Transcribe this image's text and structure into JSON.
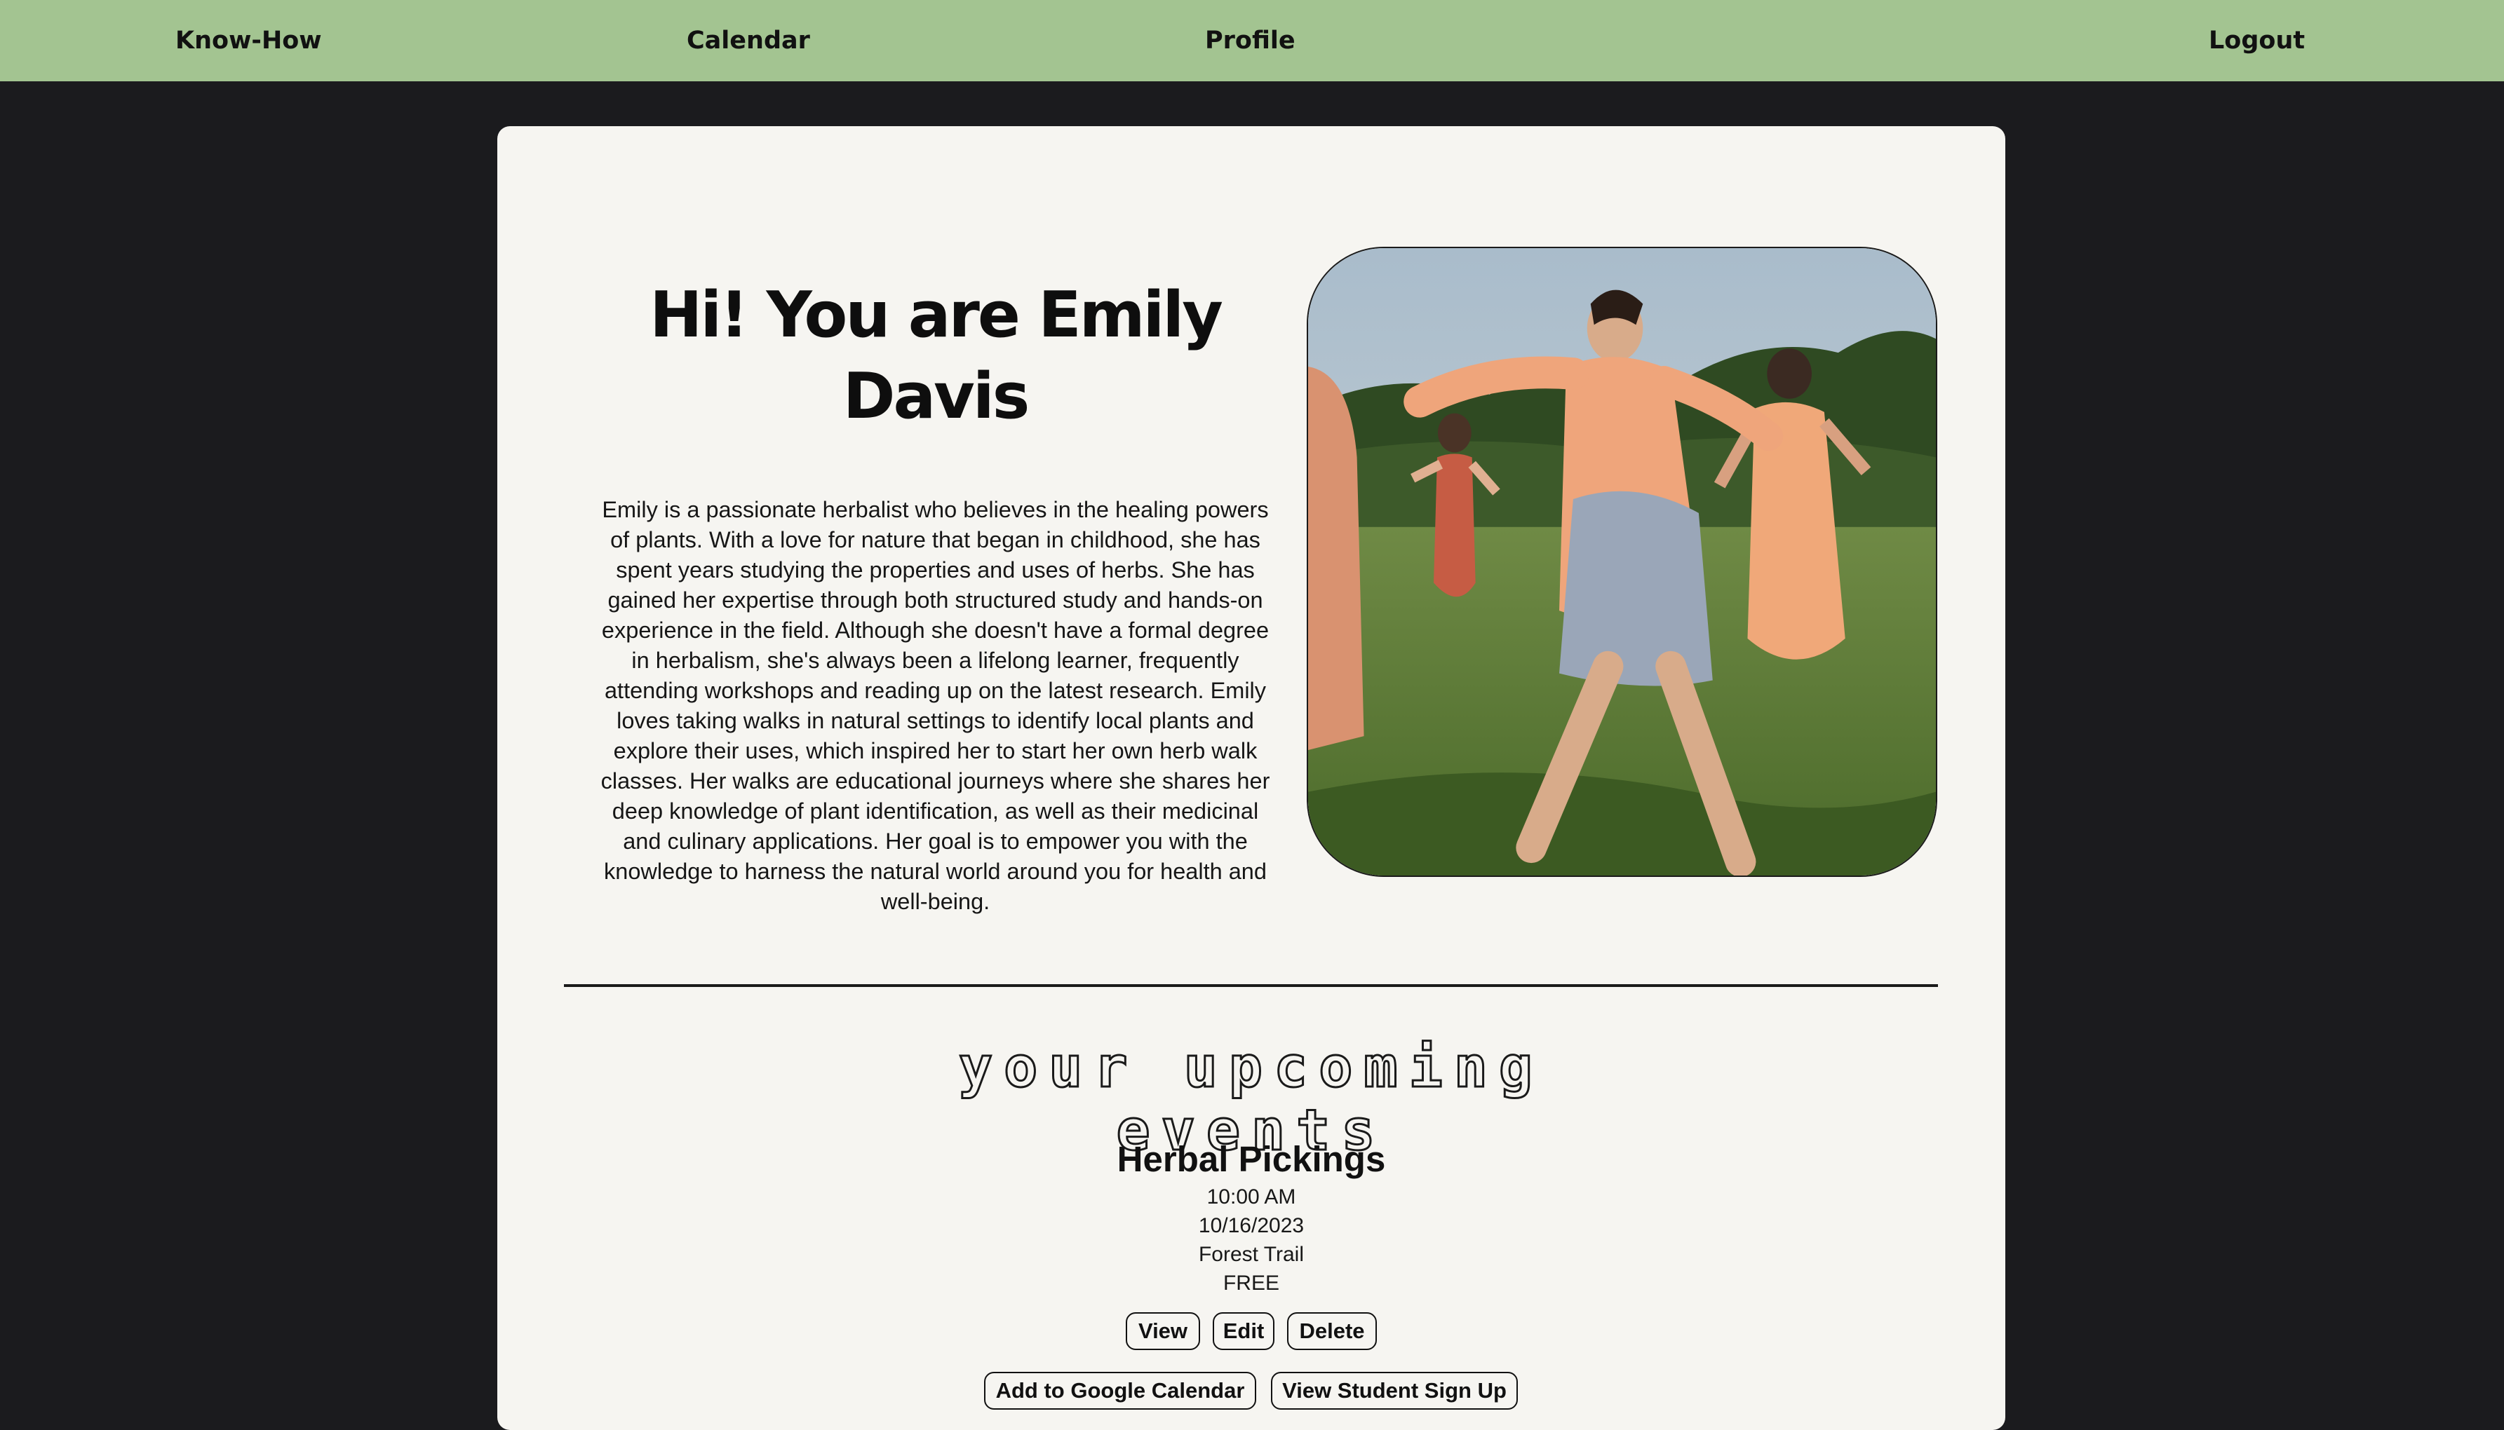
{
  "nav": {
    "knowhow": "Know-How",
    "calendar": "Calendar",
    "profile": "Profile",
    "logout": "Logout"
  },
  "profile": {
    "greeting": "Hi! You are Emily Davis",
    "bio": "Emily is a passionate herbalist who believes in the healing powers of plants. With a love for nature that began in childhood, she has spent years studying the properties and uses of herbs. She has gained her expertise through both structured study and hands-on experience in the field. Although she doesn't have a formal degree in herbalism, she's always been a lifelong learner, frequently attending workshops and reading up on the latest research. Emily loves taking walks in natural settings to identify local plants and explore their uses, which inspired her to start her own herb walk classes. Her walks are educational journeys where she shares her deep knowledge of plant identification, as well as their medicinal and culinary applications. Her goal is to empower you with the knowledge to harness the natural world around you for health and well-being."
  },
  "events_section": {
    "title": "your upcoming events"
  },
  "event": {
    "name": "Herbal Pickings",
    "time": "10:00 AM",
    "date": "10/16/2023",
    "location": "Forest Trail",
    "price": "FREE",
    "view_label": "View",
    "edit_label": "Edit",
    "delete_label": "Delete",
    "gcal_label": "Add to Google Calendar",
    "signup_label": "View Student Sign Up"
  },
  "colors": {
    "nav_background": "#a3c491",
    "page_background": "#1b1b1e",
    "card_background": "#f6f5f1"
  }
}
